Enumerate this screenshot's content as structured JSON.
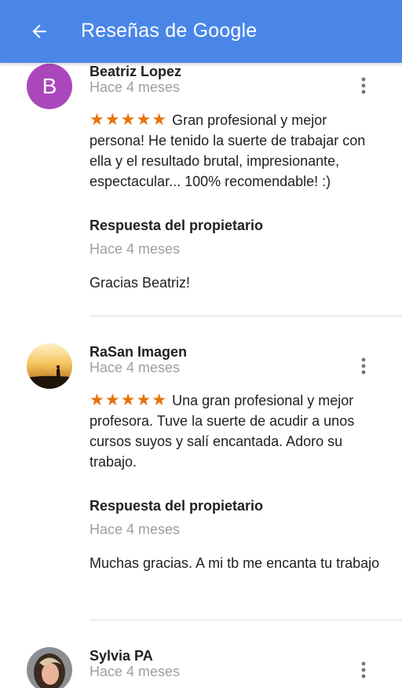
{
  "appbar": {
    "title": "Reseñas de Google",
    "background": "#4a86e8",
    "back_icon": "arrow-left-icon"
  },
  "reviews": [
    {
      "author": "Beatriz Lopez",
      "avatar_letter": "B",
      "avatar_color": "#ab47bc",
      "age": "Hace 4 meses",
      "rating": 5,
      "stars": "★★★★★",
      "text": "Gran profesional y mejor persona! He tenido la suerte de trabajar con ella y el resultado brutal, impresionante, espectacular... 100% recomendable! :)",
      "reply_title": "Respuesta del propietario",
      "reply_age": "Hace 4 meses",
      "reply_text": "Gracias Beatriz!"
    },
    {
      "author": "RaSan Imagen",
      "avatar": "sunset-photo",
      "age": "Hace 4 meses",
      "rating": 5,
      "stars": "★★★★★",
      "text": "Una gran profesional y mejor profesora. Tuve la suerte de acudir a unos cursos suyos y salí encantada. Adoro su trabajo.",
      "reply_title": "Respuesta del propietario",
      "reply_age": "Hace 4 meses",
      "reply_text": "Muchas gracias. A mi tb me encanta tu trabajo"
    },
    {
      "author": "Sylvia PA",
      "avatar": "portrait-photo",
      "age": "Hace 4 meses"
    }
  ],
  "colors": {
    "star": "#e8710a",
    "secondary_text": "#9e9e9e",
    "divider": "#dcdcdc"
  }
}
